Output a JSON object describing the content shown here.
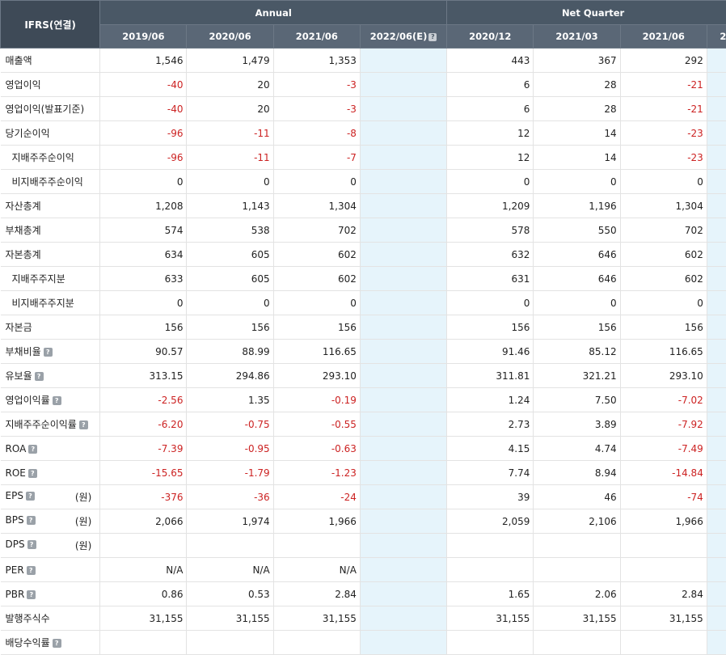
{
  "header": {
    "corner": "IFRS(연결)",
    "annual_label": "Annual",
    "quarter_label": "Net Quarter",
    "periods": [
      "2019/06",
      "2020/06",
      "2021/06",
      "2022/06(E)",
      "2020/12",
      "2021/03",
      "2021/06",
      "2"
    ]
  },
  "rows": [
    {
      "label": "매출액",
      "indent": false,
      "values": [
        "1,546",
        "1,479",
        "1,353",
        "",
        "443",
        "367",
        "292",
        ""
      ]
    },
    {
      "label": "영업이익",
      "indent": false,
      "values": [
        "-40",
        "20",
        "-3",
        "",
        "6",
        "28",
        "-21",
        ""
      ]
    },
    {
      "label": "영업이익(발표기준)",
      "indent": false,
      "values": [
        "-40",
        "20",
        "-3",
        "",
        "6",
        "28",
        "-21",
        ""
      ]
    },
    {
      "label": "당기순이익",
      "indent": false,
      "values": [
        "-96",
        "-11",
        "-8",
        "",
        "12",
        "14",
        "-23",
        ""
      ]
    },
    {
      "label": "지배주주순이익",
      "indent": true,
      "values": [
        "-96",
        "-11",
        "-7",
        "",
        "12",
        "14",
        "-23",
        ""
      ]
    },
    {
      "label": "비지배주주순이익",
      "indent": true,
      "values": [
        "0",
        "0",
        "0",
        "",
        "0",
        "0",
        "0",
        ""
      ]
    },
    {
      "label": "자산총계",
      "indent": false,
      "values": [
        "1,208",
        "1,143",
        "1,304",
        "",
        "1,209",
        "1,196",
        "1,304",
        ""
      ]
    },
    {
      "label": "부채총계",
      "indent": false,
      "values": [
        "574",
        "538",
        "702",
        "",
        "578",
        "550",
        "702",
        ""
      ]
    },
    {
      "label": "자본총계",
      "indent": false,
      "values": [
        "634",
        "605",
        "602",
        "",
        "632",
        "646",
        "602",
        ""
      ]
    },
    {
      "label": "지배주주지분",
      "indent": true,
      "values": [
        "633",
        "605",
        "602",
        "",
        "631",
        "646",
        "602",
        ""
      ]
    },
    {
      "label": "비지배주주지분",
      "indent": true,
      "values": [
        "0",
        "0",
        "0",
        "",
        "0",
        "0",
        "0",
        ""
      ]
    },
    {
      "label": "자본금",
      "indent": false,
      "values": [
        "156",
        "156",
        "156",
        "",
        "156",
        "156",
        "156",
        ""
      ]
    },
    {
      "label": "부채비율",
      "indent": false,
      "hint": true,
      "values": [
        "90.57",
        "88.99",
        "116.65",
        "",
        "91.46",
        "85.12",
        "116.65",
        ""
      ]
    },
    {
      "label": "유보율",
      "indent": false,
      "hint": true,
      "values": [
        "313.15",
        "294.86",
        "293.10",
        "",
        "311.81",
        "321.21",
        "293.10",
        ""
      ]
    },
    {
      "label": "영업이익률",
      "indent": false,
      "hint": true,
      "values": [
        "-2.56",
        "1.35",
        "-0.19",
        "",
        "1.24",
        "7.50",
        "-7.02",
        ""
      ]
    },
    {
      "label": "지배주주순이익률",
      "indent": false,
      "hint": true,
      "values": [
        "-6.20",
        "-0.75",
        "-0.55",
        "",
        "2.73",
        "3.89",
        "-7.92",
        ""
      ]
    },
    {
      "label": "ROA",
      "indent": false,
      "hint": true,
      "values": [
        "-7.39",
        "-0.95",
        "-0.63",
        "",
        "4.15",
        "4.74",
        "-7.49",
        ""
      ]
    },
    {
      "label": "ROE",
      "indent": false,
      "hint": true,
      "values": [
        "-15.65",
        "-1.79",
        "-1.23",
        "",
        "7.74",
        "8.94",
        "-14.84",
        ""
      ]
    },
    {
      "label": "EPS",
      "indent": false,
      "hint": true,
      "unit": "(원)",
      "values": [
        "-376",
        "-36",
        "-24",
        "",
        "39",
        "46",
        "-74",
        ""
      ]
    },
    {
      "label": "BPS",
      "indent": false,
      "hint": true,
      "unit": "(원)",
      "values": [
        "2,066",
        "1,974",
        "1,966",
        "",
        "2,059",
        "2,106",
        "1,966",
        ""
      ]
    },
    {
      "label": "DPS",
      "indent": false,
      "hint": true,
      "unit": "(원)",
      "values": [
        "",
        "",
        "",
        "",
        "",
        "",
        "",
        ""
      ]
    },
    {
      "label": "PER",
      "indent": false,
      "hint": true,
      "values": [
        "N/A",
        "N/A",
        "N/A",
        "",
        "",
        "",
        "",
        ""
      ]
    },
    {
      "label": "PBR",
      "indent": false,
      "hint": true,
      "values": [
        "0.86",
        "0.53",
        "2.84",
        "",
        "1.65",
        "2.06",
        "2.84",
        ""
      ]
    },
    {
      "label": "발행주식수",
      "indent": false,
      "values": [
        "31,155",
        "31,155",
        "31,155",
        "",
        "31,155",
        "31,155",
        "31,155",
        ""
      ]
    },
    {
      "label": "배당수익률",
      "indent": false,
      "hint": true,
      "values": [
        "",
        "",
        "",
        "",
        "",
        "",
        "",
        ""
      ]
    }
  ],
  "icons": {
    "hint": "?"
  },
  "colors": {
    "negative": "#cc2222",
    "estimate_bg": "#e6f4fb",
    "header_bg": "#4a5866"
  }
}
